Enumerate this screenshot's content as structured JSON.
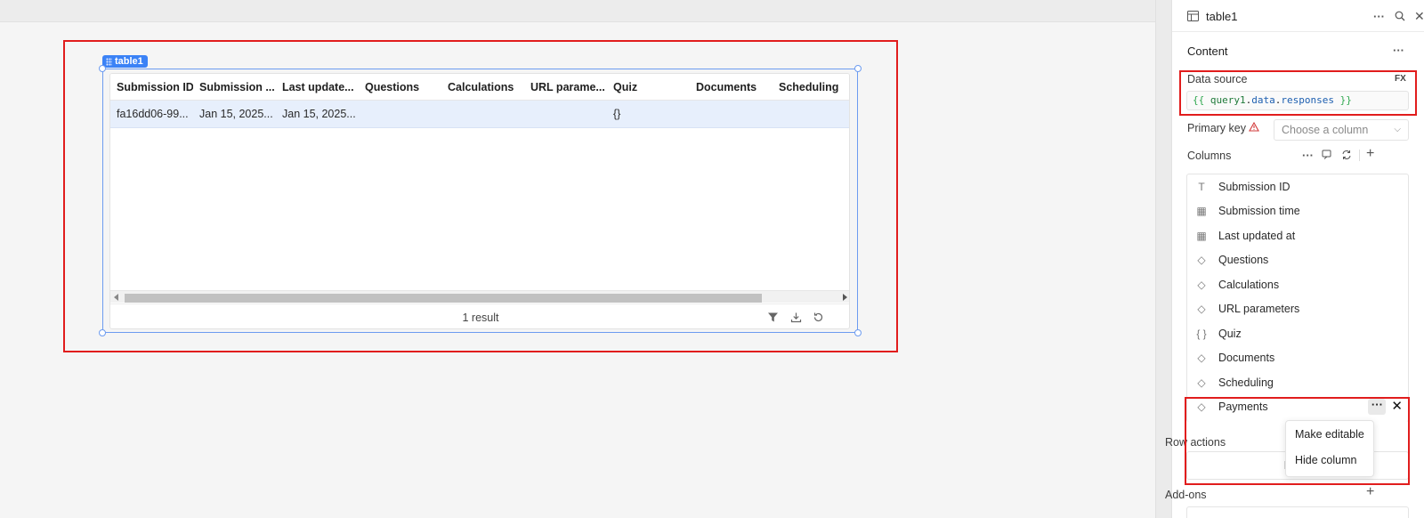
{
  "component": {
    "tag": "table1"
  },
  "table": {
    "columns": [
      "Submission ID",
      "Submission ...",
      "Last update...",
      "Questions",
      "Calculations",
      "URL parame...",
      "Quiz",
      "Documents",
      "Scheduling"
    ],
    "rows": [
      [
        "fa16dd06-99...",
        "Jan 15, 2025...",
        "Jan 15, 2025...",
        "",
        "",
        "",
        "{}",
        "",
        ""
      ]
    ],
    "result_count": "1 result",
    "footer_icons": [
      "filter-icon",
      "download-icon",
      "refresh-icon"
    ]
  },
  "panel": {
    "title": "table1",
    "content_label": "Content",
    "data_source": {
      "label": "Data source",
      "fx": "FX",
      "open": "{{",
      "identifier": "query1",
      "dot1": ".",
      "prop1": "data",
      "dot2": ".",
      "prop2": "responses",
      "close": "}}"
    },
    "primary_key": {
      "label": "Primary key",
      "placeholder": "Choose a column"
    },
    "columns_label": "Columns",
    "columns": [
      {
        "icon": "text-icon",
        "glyph": "T",
        "label": "Submission ID"
      },
      {
        "icon": "calendar-icon",
        "glyph": "▦",
        "label": "Submission time"
      },
      {
        "icon": "calendar-icon",
        "glyph": "▦",
        "label": "Last updated at"
      },
      {
        "icon": "tag-icon",
        "glyph": "◇",
        "label": "Questions"
      },
      {
        "icon": "tag-icon",
        "glyph": "◇",
        "label": "Calculations"
      },
      {
        "icon": "tag-icon",
        "glyph": "◇",
        "label": "URL parameters"
      },
      {
        "icon": "json-icon",
        "glyph": "{ }",
        "label": "Quiz"
      },
      {
        "icon": "tag-icon",
        "glyph": "◇",
        "label": "Documents"
      },
      {
        "icon": "tag-icon",
        "glyph": "◇",
        "label": "Scheduling"
      },
      {
        "icon": "tag-icon",
        "glyph": "◇",
        "label": "Payments"
      }
    ],
    "row_actions_label": "Row actions",
    "no_actions_text": "No ac",
    "addons_label": "Add-ons",
    "menu": {
      "make_editable": "Make editable",
      "hide_column": "Hide column"
    }
  },
  "colors": {
    "accent": "#3b82f6",
    "highlight": "#e11d1d",
    "row_selected": "#e7effc"
  }
}
